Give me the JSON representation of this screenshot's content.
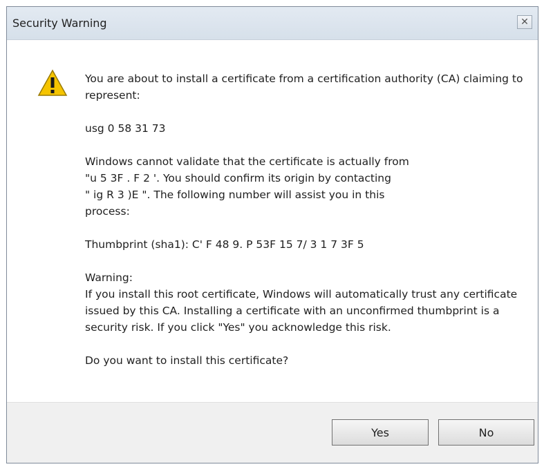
{
  "window": {
    "title": "Security Warning",
    "close_symbol": "✕"
  },
  "message": {
    "intro": "You are about to install a certificate from a certification authority (CA) claiming to represent:",
    "ca_name": "usg 0 58 31 73",
    "validate_line1": "Windows cannot validate that the certificate is actually from",
    "validate_line2": "\"u 5 3F . F 2 '. You should confirm its origin by contacting",
    "validate_line3": "\" ig R 3 )E \". The following number will assist you in this",
    "validate_line4": "process:",
    "thumbprint": "Thumbprint (sha1): C' F 48 9. P 53F 15 7/ 3 1 7 3F 5",
    "warning_label": "Warning:",
    "warning_text": "If you install this root certificate, Windows will automatically trust any certificate issued by this CA. Installing a certificate with an unconfirmed thumbprint is a security risk. If you click \"Yes\" you acknowledge this risk.",
    "question": "Do you want to install this certificate?"
  },
  "buttons": {
    "yes": "Yes",
    "no": "No"
  },
  "icons": {
    "warning": "warning-icon",
    "close": "close-icon"
  },
  "colors": {
    "warning_fill": "#f5c400",
    "titlebar": "#dbe4ee"
  }
}
